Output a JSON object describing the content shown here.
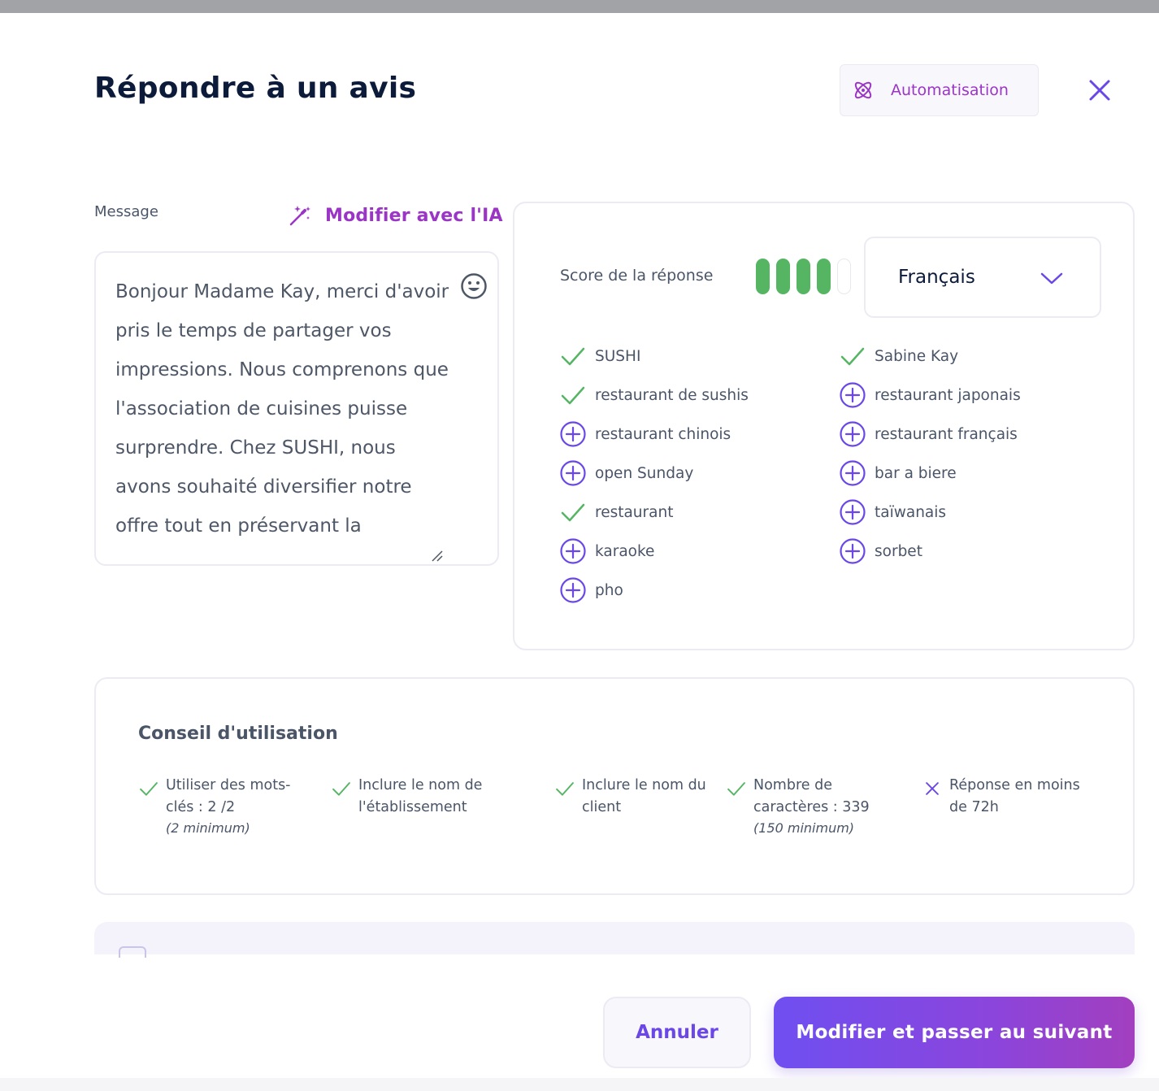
{
  "header": {
    "title": "Répondre à un avis",
    "automation_label": "Automatisation"
  },
  "message": {
    "label": "Message",
    "ai_label": "Modifier avec l'IA",
    "text": "Bonjour Madame Kay, merci d'avoir pris le temps de partager vos impressions. Nous comprenons que l'association de cuisines puisse surprendre. Chez SUSHI, nous avons souhaité diversifier notre offre tout en préservant la"
  },
  "score": {
    "label": "Score de la réponse",
    "value": 4,
    "max": 5,
    "language": "Français"
  },
  "keywords": {
    "left": [
      {
        "label": "SUSHI",
        "status": "check"
      },
      {
        "label": "restaurant de sushis",
        "status": "check"
      },
      {
        "label": "restaurant chinois",
        "status": "add"
      },
      {
        "label": "open Sunday",
        "status": "add"
      },
      {
        "label": "restaurant",
        "status": "check"
      },
      {
        "label": "karaoke",
        "status": "add"
      },
      {
        "label": "pho",
        "status": "add"
      }
    ],
    "right": [
      {
        "label": "Sabine Kay",
        "status": "check"
      },
      {
        "label": "restaurant japonais",
        "status": "add"
      },
      {
        "label": "restaurant français",
        "status": "add"
      },
      {
        "label": "bar a biere",
        "status": "add"
      },
      {
        "label": "taïwanais",
        "status": "add"
      },
      {
        "label": "sorbet",
        "status": "add"
      }
    ]
  },
  "tips": {
    "title": "Conseil d'utilisation",
    "items": [
      {
        "line1": "Utiliser des mots-",
        "line2": "clés : 2 /2",
        "sub": "(2 minimum)",
        "ok": true
      },
      {
        "line1": "Inclure le nom de",
        "line2": "l'établissement",
        "sub": "",
        "ok": true
      },
      {
        "line1": "Inclure le nom du",
        "line2": "client",
        "sub": "",
        "ok": true
      },
      {
        "line1": "Nombre de",
        "line2": "caractères : 339",
        "sub": "(150 minimum)",
        "ok": true
      },
      {
        "line1": "Réponse en moins",
        "line2": "de 72h",
        "sub": "",
        "ok": false
      }
    ]
  },
  "actions": {
    "cancel_label": "Annuler",
    "submit_label": "Modifier et passer au suivant"
  },
  "colors": {
    "accent": "#6a47e6",
    "magenta": "#9b35c6",
    "success": "#55b562"
  },
  "icons": {
    "automation": "atom-icon",
    "close": "close-icon",
    "ai": "magic-wand-icon",
    "emoji": "smiley-icon",
    "check": "check-icon",
    "add": "plus-circle-icon",
    "fail": "cross-icon",
    "chevron": "chevron-down-icon"
  }
}
